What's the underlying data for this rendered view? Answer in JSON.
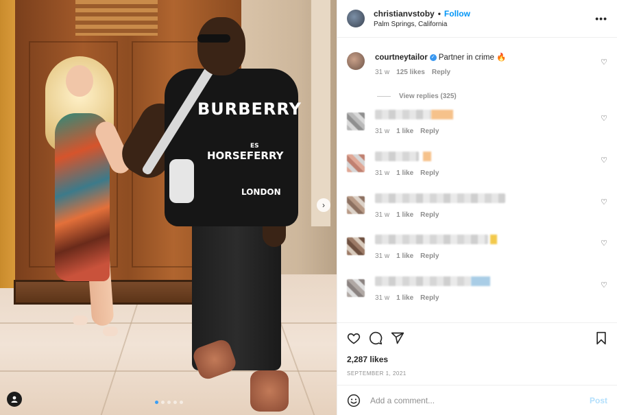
{
  "post": {
    "username": "christianvstoby",
    "separator": "•",
    "follow_label": "Follow",
    "location": "Palm Springs, California",
    "more_label": "•••"
  },
  "photo": {
    "shirt_text": [
      "BURBERRY",
      "ES",
      "HORSEFERRY",
      "LONDON"
    ],
    "carousel_count": 5,
    "carousel_active_index": 0,
    "next_label": "›"
  },
  "comments": [
    {
      "username": "courtneytailor",
      "text": "Partner in crime 🔥",
      "time": "31 w",
      "likes": "125 likes",
      "reply": "Reply"
    },
    {
      "username": "",
      "text": "",
      "time": "31 w",
      "likes": "1 like",
      "reply": "Reply"
    },
    {
      "username": "",
      "text": "",
      "time": "31 w",
      "likes": "1 like",
      "reply": "Reply"
    },
    {
      "username": "",
      "text": "",
      "time": "31 w",
      "likes": "1 like",
      "reply": "Reply"
    },
    {
      "username": "",
      "text": "",
      "time": "31 w",
      "likes": "1 like",
      "reply": "Reply"
    },
    {
      "username": "",
      "text": "",
      "time": "31 w",
      "likes": "1 like",
      "reply": "Reply"
    }
  ],
  "view_replies": "View replies (325)",
  "heart_icon": "♡",
  "footer": {
    "likes": "2,287 likes",
    "date": "SEPTEMBER 1, 2021",
    "comment_placeholder": "Add a comment...",
    "post_label": "Post"
  },
  "colors": {
    "accent": "#0095f6",
    "post_disabled": "#b2dffc",
    "muted": "#8e8e8e"
  }
}
